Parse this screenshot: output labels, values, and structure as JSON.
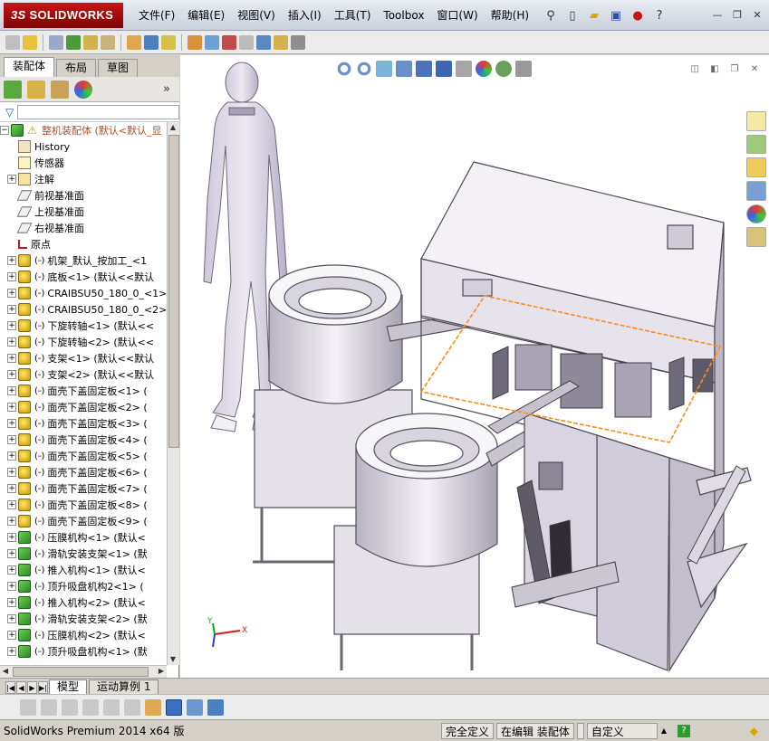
{
  "app": {
    "brand_prefix": "3S",
    "brand": "SOLIDWORKS"
  },
  "menu": [
    "文件(F)",
    "编辑(E)",
    "视图(V)",
    "插入(I)",
    "工具(T)",
    "Toolbox",
    "窗口(W)",
    "帮助(H)"
  ],
  "panel_tabs": [
    "装配体",
    "布局",
    "草图"
  ],
  "tree": {
    "root": "整机装配体  (默认<默认_显",
    "items": [
      {
        "mod": "",
        "label": "History",
        "type": "history",
        "exp": false
      },
      {
        "mod": "",
        "label": "传感器",
        "type": "sensor",
        "exp": false
      },
      {
        "mod": "",
        "label": "注解",
        "type": "annot",
        "exp": true
      },
      {
        "mod": "",
        "label": "前视基准面",
        "type": "plane",
        "exp": false
      },
      {
        "mod": "",
        "label": "上视基准面",
        "type": "plane",
        "exp": false
      },
      {
        "mod": "",
        "label": "右视基准面",
        "type": "plane",
        "exp": false
      },
      {
        "mod": "",
        "label": "原点",
        "type": "origin",
        "exp": false
      },
      {
        "mod": "(-)",
        "label": "机架_默认_按加工_<1",
        "type": "part",
        "exp": true
      },
      {
        "mod": "(-)",
        "label": "底板<1> (默认<<默认",
        "type": "part",
        "exp": true
      },
      {
        "mod": "(-)",
        "label": "CRAIBSU50_180_0_<1>",
        "type": "part",
        "exp": true
      },
      {
        "mod": "(-)",
        "label": "CRAIBSU50_180_0_<2>",
        "type": "part",
        "exp": true
      },
      {
        "mod": "(-)",
        "label": "下旋转轴<1> (默认<<",
        "type": "part",
        "exp": true
      },
      {
        "mod": "(-)",
        "label": "下旋转轴<2> (默认<<",
        "type": "part",
        "exp": true
      },
      {
        "mod": "(-)",
        "label": "支架<1> (默认<<默认",
        "type": "part",
        "exp": true
      },
      {
        "mod": "(-)",
        "label": "支架<2> (默认<<默认",
        "type": "part",
        "exp": true
      },
      {
        "mod": "(-)",
        "label": "面壳下盖固定板<1> (",
        "type": "part",
        "exp": true
      },
      {
        "mod": "(-)",
        "label": "面壳下盖固定板<2> (",
        "type": "part",
        "exp": true
      },
      {
        "mod": "(-)",
        "label": "面壳下盖固定板<3> (",
        "type": "part",
        "exp": true
      },
      {
        "mod": "(-)",
        "label": "面壳下盖固定板<4> (",
        "type": "part",
        "exp": true
      },
      {
        "mod": "(-)",
        "label": "面壳下盖固定板<5> (",
        "type": "part",
        "exp": true
      },
      {
        "mod": "(-)",
        "label": "面壳下盖固定板<6> (",
        "type": "part",
        "exp": true
      },
      {
        "mod": "(-)",
        "label": "面壳下盖固定板<7> (",
        "type": "part",
        "exp": true
      },
      {
        "mod": "(-)",
        "label": "面壳下盖固定板<8> (",
        "type": "part",
        "exp": true
      },
      {
        "mod": "(-)",
        "label": "面壳下盖固定板<9> (",
        "type": "part",
        "exp": true
      },
      {
        "mod": "(-)",
        "label": "压膜机构<1> (默认<",
        "type": "sub",
        "exp": true
      },
      {
        "mod": "(-)",
        "label": "滑轨安装支架<1> (默",
        "type": "sub",
        "exp": true
      },
      {
        "mod": "(-)",
        "label": "推入机构<1> (默认<",
        "type": "sub",
        "exp": true
      },
      {
        "mod": "(-)",
        "label": "顶升吸盘机构2<1> (",
        "type": "sub",
        "exp": true
      },
      {
        "mod": "(-)",
        "label": "推入机构<2> (默认<",
        "type": "sub",
        "exp": true
      },
      {
        "mod": "(-)",
        "label": "滑轨安装支架<2> (默",
        "type": "sub",
        "exp": true
      },
      {
        "mod": "(-)",
        "label": "压膜机构<2> (默认<",
        "type": "sub",
        "exp": true
      },
      {
        "mod": "(-)",
        "label": "顶升吸盘机构<1> (默",
        "type": "sub",
        "exp": true
      }
    ]
  },
  "bottom_tabs": [
    "模型",
    "运动算例 1"
  ],
  "status": {
    "product": "SolidWorks Premium 2014 x64 版",
    "defined": "完全定义",
    "editing": "在编辑 装配体",
    "units": "自定义",
    "arrow": "▲"
  },
  "colors": {
    "accent": "#c81414",
    "selection": "#ff8c1a",
    "body": "#dcd6e6"
  },
  "viewport": {
    "axis_label_x": "X",
    "axis_label_y": "Y"
  }
}
